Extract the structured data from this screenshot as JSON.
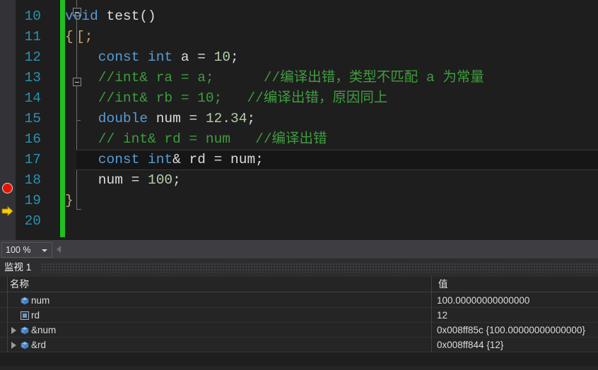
{
  "editor": {
    "zoom_level": "100 %",
    "lines": [
      {
        "number": "10",
        "tokens": [
          {
            "t": "kw",
            "s": "void"
          },
          {
            "t": "id",
            "s": " test"
          },
          {
            "t": "punct",
            "s": "()"
          }
        ]
      },
      {
        "number": "11",
        "tokens": [
          {
            "t": "brace",
            "s": "{"
          }
        ]
      },
      {
        "number": "12",
        "tokens": [
          {
            "t": "kw",
            "s": "    const int"
          },
          {
            "t": "id",
            "s": " a "
          },
          {
            "t": "punct",
            "s": "= "
          },
          {
            "t": "num",
            "s": "10"
          },
          {
            "t": "punct",
            "s": ";"
          }
        ]
      },
      {
        "number": "13",
        "tokens": [
          {
            "t": "cmt",
            "s": "    //int& ra = a;      //编译出错，类型不匹配 a 为常量"
          }
        ]
      },
      {
        "number": "14",
        "tokens": [
          {
            "t": "cmt",
            "s": "    //int& rb = 10;   //编译出错，原因同上"
          }
        ]
      },
      {
        "number": "15",
        "tokens": [
          {
            "t": "kw",
            "s": "    double"
          },
          {
            "t": "id",
            "s": " num "
          },
          {
            "t": "punct",
            "s": "= "
          },
          {
            "t": "num",
            "s": "12.34"
          },
          {
            "t": "punct",
            "s": ";"
          }
        ]
      },
      {
        "number": "16",
        "tokens": [
          {
            "t": "cmt",
            "s": "    // int& rd = num   //编译出错"
          }
        ]
      },
      {
        "number": "17",
        "tokens": [
          {
            "t": "kw",
            "s": "    const int"
          },
          {
            "t": "punct",
            "s": "&"
          },
          {
            "t": "id",
            "s": " rd "
          },
          {
            "t": "punct",
            "s": "= "
          },
          {
            "t": "id",
            "s": "num"
          },
          {
            "t": "punct",
            "s": ";"
          }
        ]
      },
      {
        "number": "18",
        "tokens": [
          {
            "t": "id",
            "s": "    num "
          },
          {
            "t": "punct",
            "s": "= "
          },
          {
            "t": "num",
            "s": "100"
          },
          {
            "t": "punct",
            "s": ";"
          }
        ]
      },
      {
        "number": "19",
        "tokens": [
          {
            "t": "brace",
            "s": "}"
          }
        ]
      },
      {
        "number": "20",
        "tokens": []
      }
    ],
    "breakpoint_line": "18",
    "current_statement_line": "19",
    "highlighted_line": "17",
    "icons": {
      "breakpoint": "breakpoint-icon",
      "current_statement": "current-statement-arrow-icon",
      "fold_collapse": "fold-collapse-icon",
      "zoom_dropdown": "chevron-down-icon",
      "hscroll_left": "scroll-left-arrow-icon"
    }
  },
  "watch": {
    "title": "监视 1",
    "columns": [
      "名称",
      "值"
    ],
    "rows": [
      {
        "name": "num",
        "value": "100.00000000000000",
        "expandable": false,
        "icon": "variable-cube-icon"
      },
      {
        "name": "rd",
        "value": "12",
        "expandable": false,
        "icon": "reference-box-icon"
      },
      {
        "name": "&num",
        "value": "0x008ff85c {100.00000000000000}",
        "expandable": true,
        "icon": "variable-cube-icon"
      },
      {
        "name": "&rd",
        "value": "0x008ff844 {12}",
        "expandable": true,
        "icon": "variable-cube-icon"
      }
    ]
  },
  "colors": {
    "editor_bg": "#1e1e1e",
    "line_number": "#2b91af",
    "keyword": "#569cd6",
    "comment": "#3f9c3f",
    "number": "#b5cea8",
    "identifier": "#dcdcdc",
    "change_bar": "#1fc21f",
    "breakpoint": "#e51400",
    "current_statement": "#ffcc00",
    "panel_bg": "#252526"
  }
}
